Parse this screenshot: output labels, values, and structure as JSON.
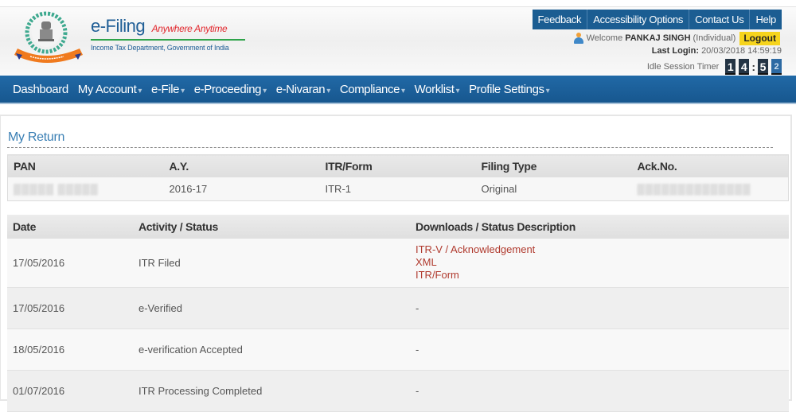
{
  "header": {
    "brand_title": "e-Filing",
    "brand_tagline": "Anywhere Anytime",
    "brand_subtitle": "Income Tax Department, Government of India",
    "top_links": [
      "Feedback",
      "Accessibility Options",
      "Contact Us",
      "Help"
    ],
    "welcome_prefix": "Welcome",
    "user_name": "PANKAJ SINGH",
    "user_type": "(Individual)",
    "logout_label": "Logout",
    "last_login_label": "Last Login:",
    "last_login_value": "20/03/2018 14:59:19",
    "idle_timer_label": "Idle Session Timer",
    "idle_timer_digits": [
      "1",
      "4",
      "5",
      "2"
    ]
  },
  "nav": {
    "items": [
      {
        "label": "Dashboard",
        "has_dropdown": false
      },
      {
        "label": "My Account",
        "has_dropdown": true
      },
      {
        "label": "e-File",
        "has_dropdown": true
      },
      {
        "label": "e-Proceeding",
        "has_dropdown": true
      },
      {
        "label": "e-Nivaran",
        "has_dropdown": true
      },
      {
        "label": "Compliance",
        "has_dropdown": true
      },
      {
        "label": "Worklist",
        "has_dropdown": true
      },
      {
        "label": "Profile Settings",
        "has_dropdown": true
      }
    ],
    "caret": "▾"
  },
  "my_return": {
    "title": "My Return",
    "columns": [
      "PAN",
      "A.Y.",
      "ITR/Form",
      "Filing Type",
      "Ack.No."
    ],
    "row": {
      "pan": "▒▒▒▒▒ ▒▒▒▒▒",
      "ay": "2016-17",
      "itr_form": "ITR-1",
      "filing_type": "Original",
      "ack_no": "▒▒▒▒▒▒▒▒▒▒▒▒▒▒"
    }
  },
  "status_table": {
    "columns": [
      "Date",
      "Activity / Status",
      "Downloads / Status Description"
    ],
    "rows": [
      {
        "date": "17/05/2016",
        "activity": "ITR Filed",
        "downloads": [
          "ITR-V / Acknowledgement",
          "XML",
          "ITR/Form"
        ]
      },
      {
        "date": "17/05/2016",
        "activity": "e-Verified",
        "description": "-"
      },
      {
        "date": "18/05/2016",
        "activity": "e-verification Accepted",
        "description": "-"
      },
      {
        "date": "01/07/2016",
        "activity": "ITR Processing Completed",
        "description": "-"
      }
    ]
  },
  "colors": {
    "brand_blue": "#1b5d92",
    "nav_blue": "#17578f",
    "tagline_red": "#e2262c",
    "rule_green": "#2ea34a",
    "logout_yellow": "#f6d41c",
    "download_link": "#b03a2e",
    "section_title": "#3a7fb4"
  }
}
